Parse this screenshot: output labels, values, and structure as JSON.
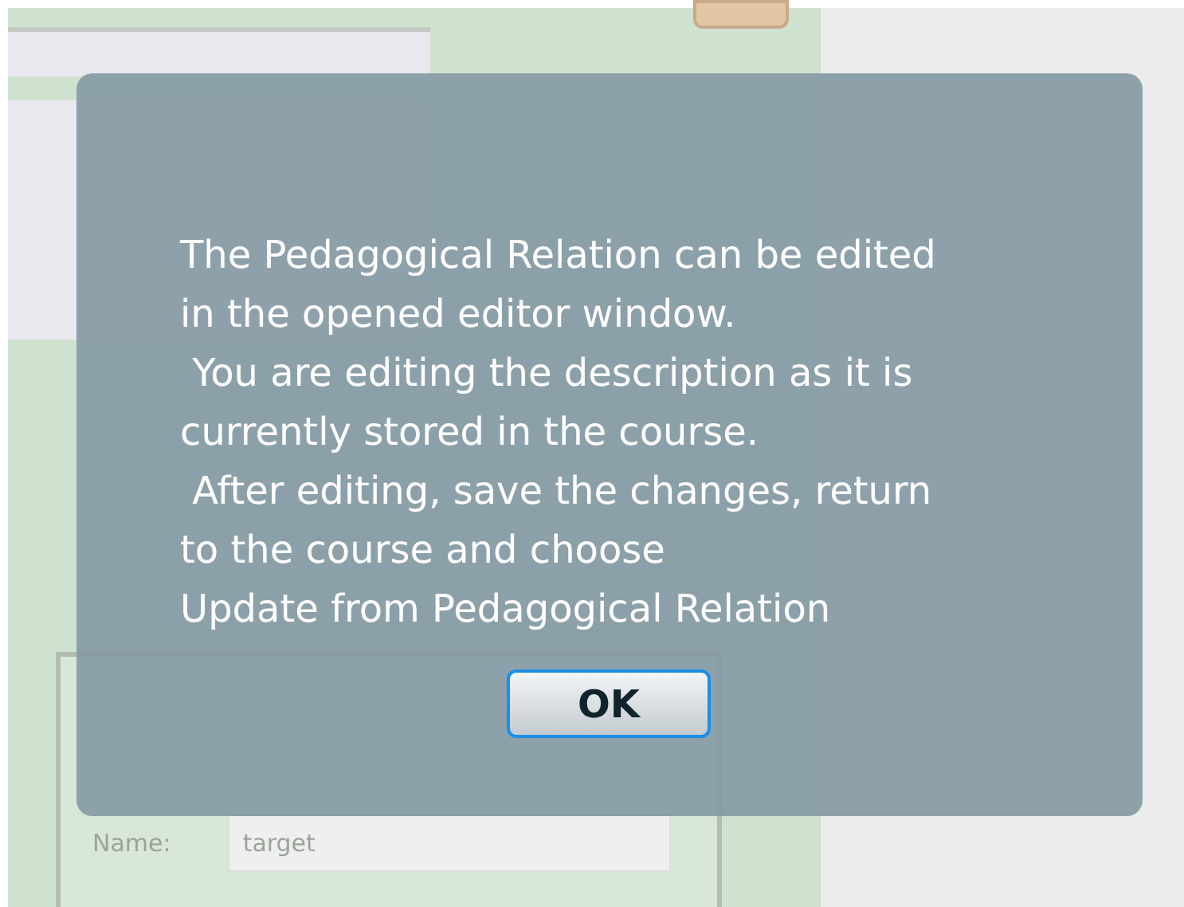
{
  "background": {
    "form": {
      "name_label": "Name:",
      "name_value": "target"
    }
  },
  "dialog": {
    "message": "The Pedagogical Relation can be edited\nin the opened editor window.\n You are editing the description as it is\ncurrently stored in the course.\n After editing, save the changes, return\nto the course and choose\nUpdate from Pedagogical Relation",
    "buttons": [
      "OK"
    ]
  }
}
